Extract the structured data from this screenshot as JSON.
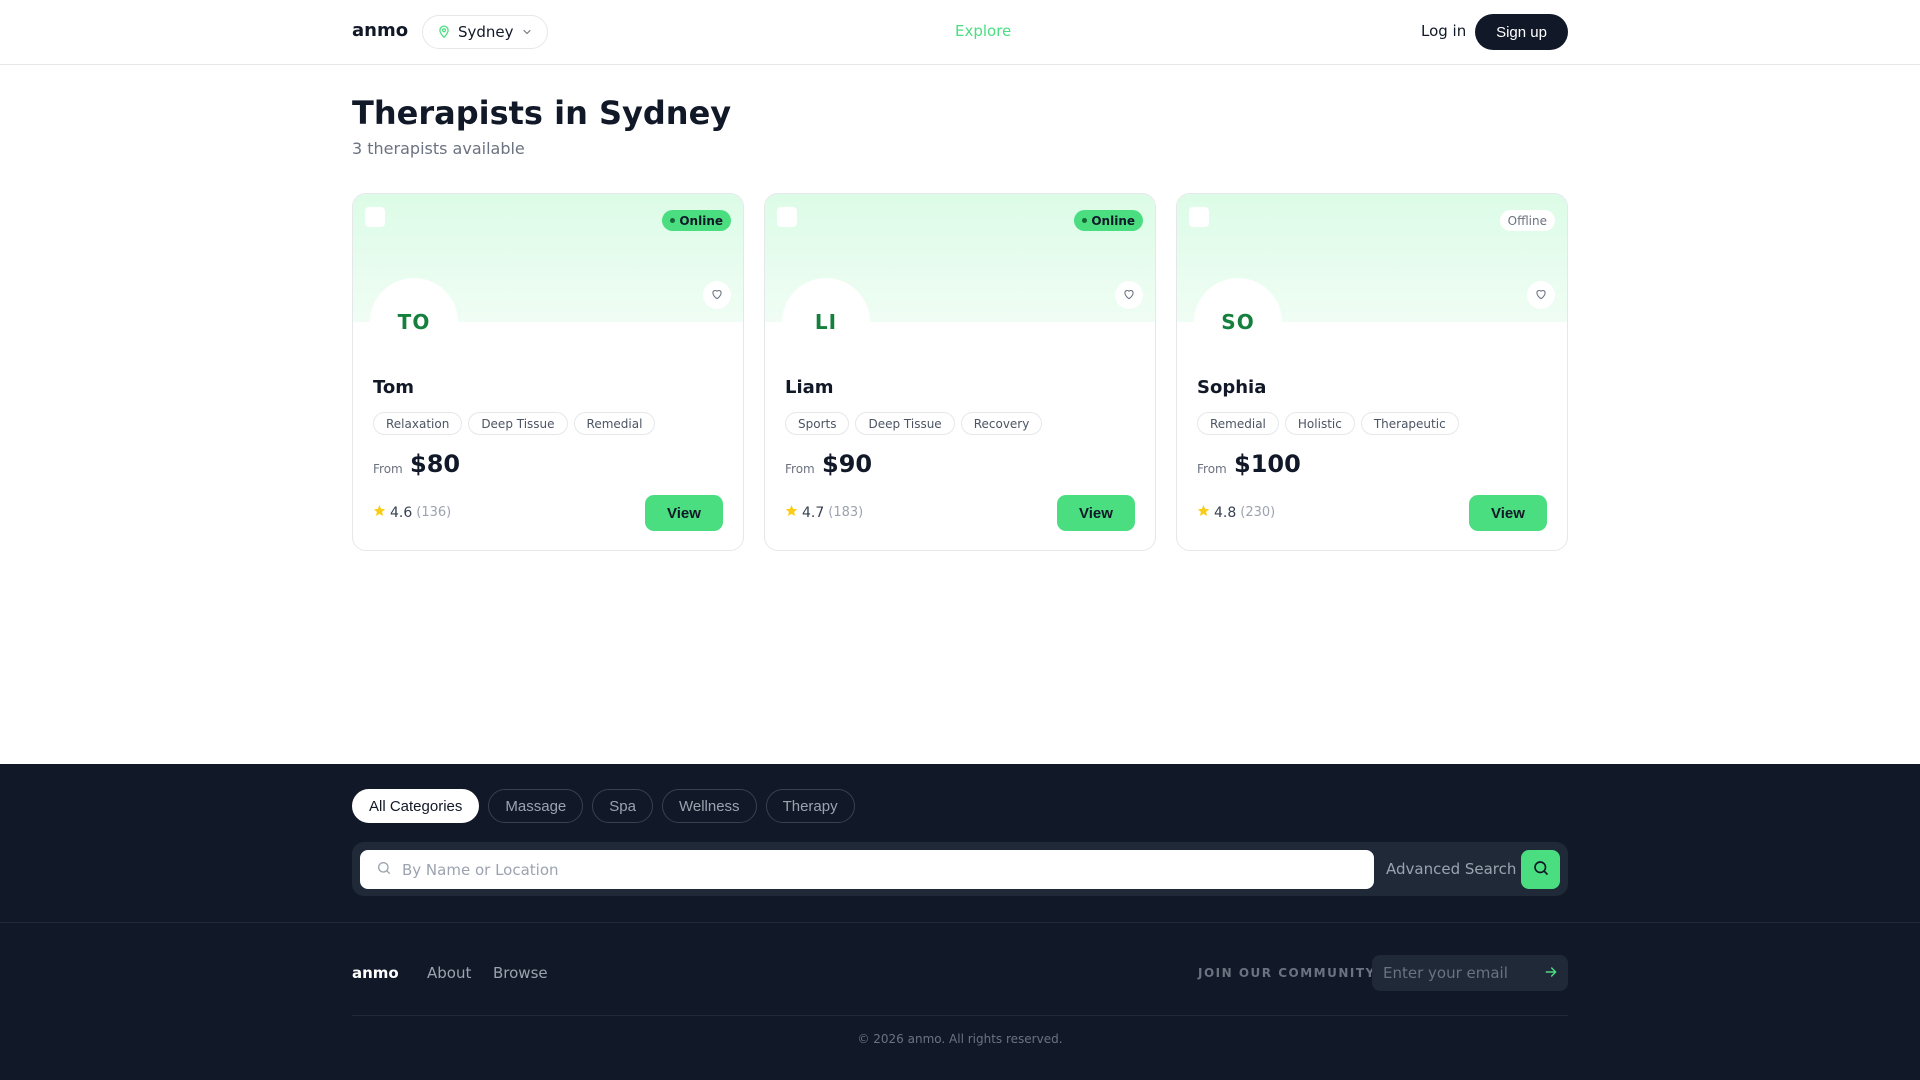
{
  "header": {
    "logo": "anmo",
    "location": "Sydney",
    "nav_explore": "Explore",
    "login": "Log in",
    "signup": "Sign up"
  },
  "page": {
    "title": "Therapists in Sydney",
    "subtitle": "3 therapists available"
  },
  "cards": [
    {
      "initials": "TO",
      "status": "Online",
      "name": "Tom",
      "tags": [
        "Relaxation",
        "Deep Tissue",
        "Remedial"
      ],
      "from_label": "From",
      "price": "$80",
      "rating": "4.6",
      "reviews": "(136)",
      "view_label": "View"
    },
    {
      "initials": "LI",
      "status": "Online",
      "name": "Liam",
      "tags": [
        "Sports",
        "Deep Tissue",
        "Recovery"
      ],
      "from_label": "From",
      "price": "$90",
      "rating": "4.7",
      "reviews": "(183)",
      "view_label": "View"
    },
    {
      "initials": "SO",
      "status": "Offline",
      "name": "Sophia",
      "tags": [
        "Remedial",
        "Holistic",
        "Therapeutic"
      ],
      "from_label": "From",
      "price": "$100",
      "rating": "4.8",
      "reviews": "(230)",
      "view_label": "View"
    }
  ],
  "search": {
    "categories": [
      "All Categories",
      "Massage",
      "Spa",
      "Wellness",
      "Therapy"
    ],
    "active_category": "All Categories",
    "placeholder": "By Name or Location",
    "advanced": "Advanced Search"
  },
  "footer": {
    "logo": "anmo",
    "about": "About",
    "browse": "Browse",
    "join": "JOIN OUR COMMUNITY",
    "email_placeholder": "Enter your email",
    "copyright": "© 2026 anmo. All rights reserved."
  },
  "colors": {
    "accent": "#4ade80",
    "dark": "#111827",
    "star": "#facc15"
  },
  "icons": {
    "location": "map-pin-icon",
    "chevron": "chevron-down-icon",
    "heart": "heart-icon",
    "star": "star-icon",
    "search": "search-icon",
    "arrow": "arrow-right-icon"
  }
}
